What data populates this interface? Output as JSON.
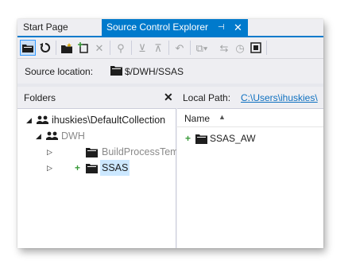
{
  "tabs": {
    "start_page": "Start Page",
    "source_control": "Source Control Explorer",
    "pin_glyph": "⊣",
    "close_glyph": "✕"
  },
  "toolbar": {
    "icons": [
      "connect-folder-icon",
      "refresh-icon",
      "new-folder-icon",
      "add-items-icon",
      "delete-icon",
      "check-out-icon",
      "get-latest-icon",
      "check-in-icon",
      "undo-icon",
      "compare-icon",
      "history-icon",
      "workspace-icon"
    ]
  },
  "source_location": {
    "label": "Source location:",
    "value": "$/DWH/SSAS"
  },
  "folders_panel": {
    "title": "Folders",
    "close_glyph": "✕",
    "tree": [
      {
        "label": "ihuskies\\DefaultCollection",
        "expander": "◢"
      },
      {
        "label": "DWH",
        "expander": "◢"
      },
      {
        "label": "BuildProcessTemplates",
        "expander": "▷"
      },
      {
        "label": "SSAS",
        "expander": "▷",
        "pending_add": "+"
      }
    ]
  },
  "files_panel": {
    "local_path_label": "Local Path:",
    "local_path_value": "C:\\Users\\ihuskies\\",
    "column_name": "Name",
    "sort_glyph": "▲",
    "items": [
      {
        "name": "SSAS_AW",
        "pending_add": "+"
      }
    ]
  },
  "colors": {
    "accent": "#007acc",
    "chrome_bg": "#eeeef2",
    "selection": "#cce8ff",
    "link": "#0e70c0",
    "add_marker": "#3a9b3a"
  }
}
